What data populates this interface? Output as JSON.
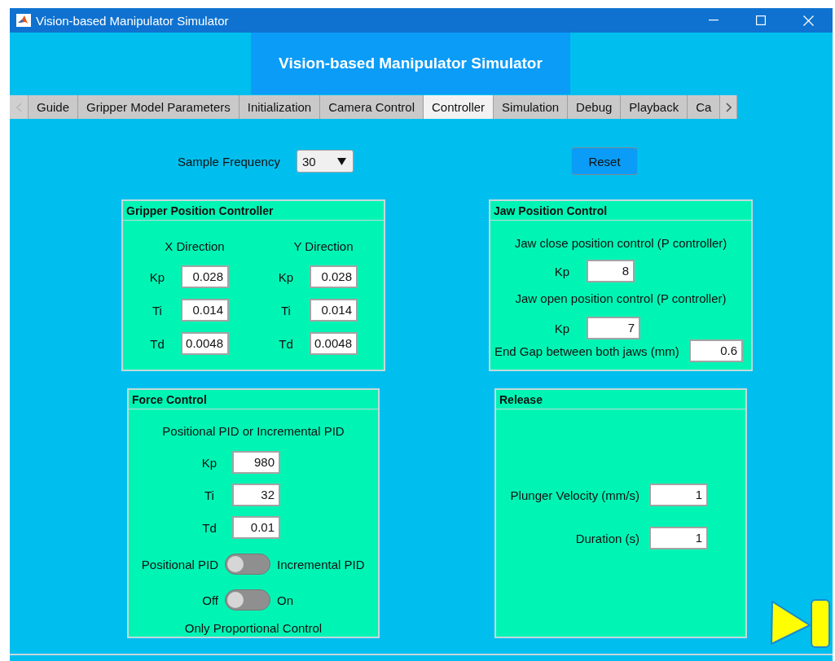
{
  "window": {
    "title": "Vision-based Manipulator Simulator"
  },
  "banner": {
    "title": "Vision-based Manipulator Simulator"
  },
  "tabs": [
    {
      "label": "Guide",
      "selected": false
    },
    {
      "label": "Gripper Model Parameters",
      "selected": false
    },
    {
      "label": "Initialization",
      "selected": false
    },
    {
      "label": "Camera Control",
      "selected": false
    },
    {
      "label": "Controller",
      "selected": true
    },
    {
      "label": "Simulation",
      "selected": false
    },
    {
      "label": "Debug",
      "selected": false
    },
    {
      "label": "Playback",
      "selected": false
    },
    {
      "label": "Ca",
      "selected": false
    }
  ],
  "sample_frequency": {
    "label": "Sample Frequency",
    "value": "30"
  },
  "reset_button": {
    "label": "Reset"
  },
  "gripper_position_controller": {
    "title": "Gripper Position Controller",
    "columns": [
      {
        "heading": "X Direction",
        "fields": [
          {
            "label": "Kp",
            "value": "0.028"
          },
          {
            "label": "Ti",
            "value": "0.014"
          },
          {
            "label": "Td",
            "value": "0.0048"
          }
        ]
      },
      {
        "heading": "Y Direction",
        "fields": [
          {
            "label": "Kp",
            "value": "0.028"
          },
          {
            "label": "Ti",
            "value": "0.014"
          },
          {
            "label": "Td",
            "value": "0.0048"
          }
        ]
      }
    ]
  },
  "jaw_position_control": {
    "title": "Jaw Position Control",
    "close_caption": "Jaw close position control (P controller)",
    "close_kp": {
      "label": "Kp",
      "value": "8"
    },
    "open_caption": "Jaw open position control (P controller)",
    "open_kp": {
      "label": "Kp",
      "value": "7"
    },
    "end_gap": {
      "label": "End Gap between both jaws (mm)",
      "value": "0.6"
    }
  },
  "force_control": {
    "title": "Force Control",
    "caption": "Positional PID or Incremental PID",
    "fields": [
      {
        "label": "Kp",
        "value": "980"
      },
      {
        "label": "Ti",
        "value": "32"
      },
      {
        "label": "Td",
        "value": "0.01"
      }
    ],
    "mode_switch": {
      "left_label": "Positional PID",
      "right_label": "Incremental PID",
      "on": false
    },
    "proportional_switch": {
      "left_label": "Off",
      "right_label": "On",
      "on": false
    },
    "proportional_caption": "Only Proportional Control"
  },
  "release": {
    "title": "Release",
    "fields": [
      {
        "label": "Plunger Velocity (mm/s)",
        "value": "1"
      },
      {
        "label": "Duration (s)",
        "value": "1"
      }
    ]
  }
}
